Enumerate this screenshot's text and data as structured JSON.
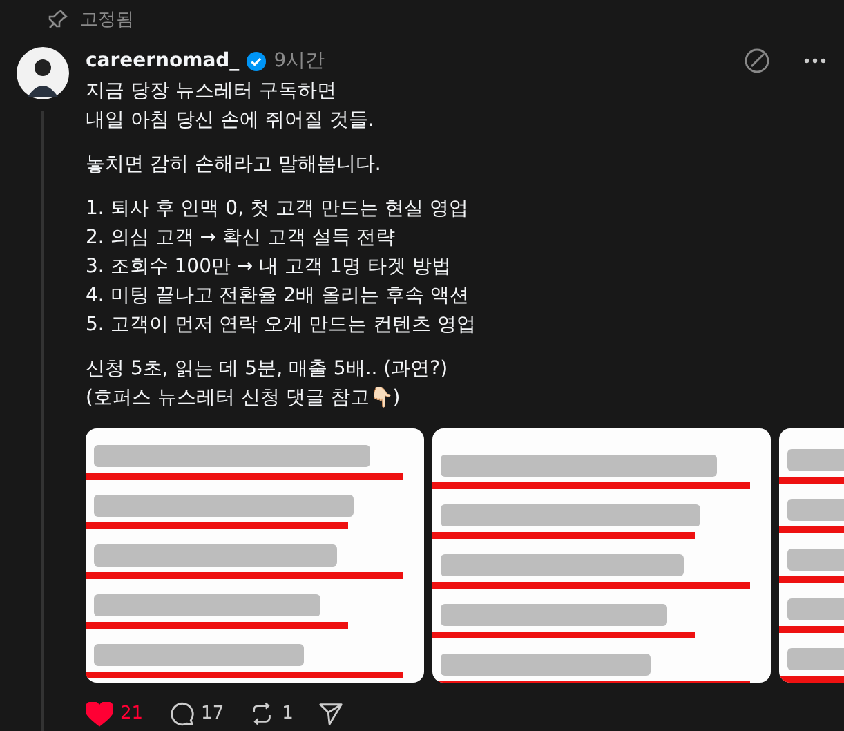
{
  "pinned": {
    "label": "고정됨"
  },
  "post": {
    "username": "careernomad_",
    "verified": true,
    "time": "9시간",
    "paragraphs": [
      [
        "지금 당장 뉴스레터 구독하면",
        "내일 아침 당신 손에 쥐어질 것들."
      ],
      [
        "놓치면 감히 손해라고 말해봅니다."
      ],
      [
        "1. 퇴사 후 인맥 0, 첫 고객 만드는 현실 영업",
        "2. 의심 고객 → 확신 고객 설득 전략",
        "3. 조회수 100만 → 내 고객 1명 타겟 방법",
        "4. 미팅 끝나고 전환율 2배 올리는 후속 액션",
        "5. 고객이 먼저 연락 오게 만드는 컨텐츠 영업"
      ],
      [
        "신청 5초, 읽는 데 5분, 매출 5배.. (과연?)",
        "(호퍼스 뉴스레터 신청 댓글 참고👇🏻)"
      ]
    ],
    "images": [
      {
        "kind": "picture"
      },
      {
        "kind": "picture"
      },
      {
        "kind": "picture"
      }
    ],
    "actions": {
      "liked": true,
      "likes": "21",
      "comments": "17",
      "reposts": "1"
    }
  }
}
